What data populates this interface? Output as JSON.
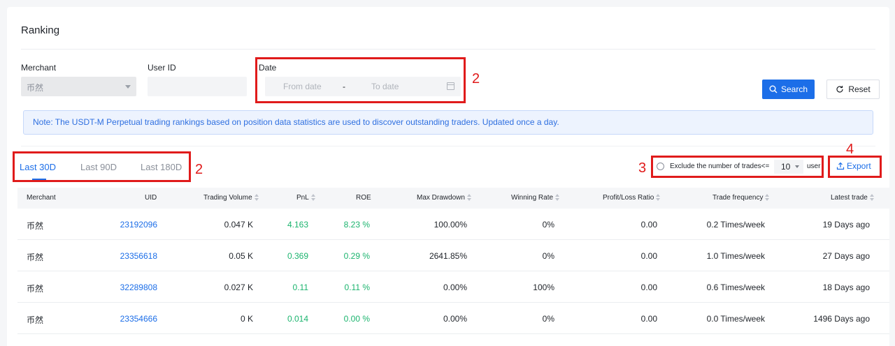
{
  "page": {
    "title": "Ranking"
  },
  "filters": {
    "merchant_label": "Merchant",
    "merchant_value": "币然",
    "user_id_label": "User ID",
    "user_id_value": "",
    "date_label": "Date",
    "from_placeholder": "From date",
    "separator": "-",
    "to_placeholder": "To date",
    "search_label": "Search",
    "reset_label": "Reset"
  },
  "note": "Note: The USDT-M Perpetual trading rankings based on position data statistics are used to discover outstanding traders. Updated once a day.",
  "tabs": [
    {
      "label": "Last 30D",
      "active": true
    },
    {
      "label": "Last 90D",
      "active": false
    },
    {
      "label": "Last 180D",
      "active": false
    }
  ],
  "toolbar": {
    "exclude_text": "Exclude the number of trades<=",
    "exclude_value": "10",
    "exclude_unit": "user",
    "export_label": "Export"
  },
  "annotations": {
    "date": "2",
    "tabs": "2",
    "exclude": "3",
    "export": "4"
  },
  "table": {
    "columns": [
      "Merchant",
      "UID",
      "Trading Volume",
      "PnL",
      "ROE",
      "Max Drawdown",
      "Winning Rate",
      "Profit/Loss Ratio",
      "Trade frequency",
      "Latest trade"
    ],
    "rows": [
      [
        "币然",
        "23192096",
        "0.047 K",
        "4.163",
        "8.23 %",
        "100.00%",
        "0%",
        "0.00",
        "0.2 Times/week",
        "19 Days ago"
      ],
      [
        "币然",
        "23356618",
        "0.05 K",
        "0.369",
        "0.29 %",
        "2641.85%",
        "0%",
        "0.00",
        "1.0 Times/week",
        "27 Days ago"
      ],
      [
        "币然",
        "32289808",
        "0.027 K",
        "0.11",
        "0.11 %",
        "0.00%",
        "100%",
        "0.00",
        "0.6 Times/week",
        "18 Days ago"
      ],
      [
        "币然",
        "23354666",
        "0 K",
        "0.014",
        "0.00 %",
        "0.00%",
        "0%",
        "0.00",
        "0.0 Times/week",
        "1496 Days ago"
      ]
    ]
  },
  "colors": {
    "accent": "#1c6ee8",
    "positive": "#1bb46e",
    "annotation": "#e01b1b"
  }
}
